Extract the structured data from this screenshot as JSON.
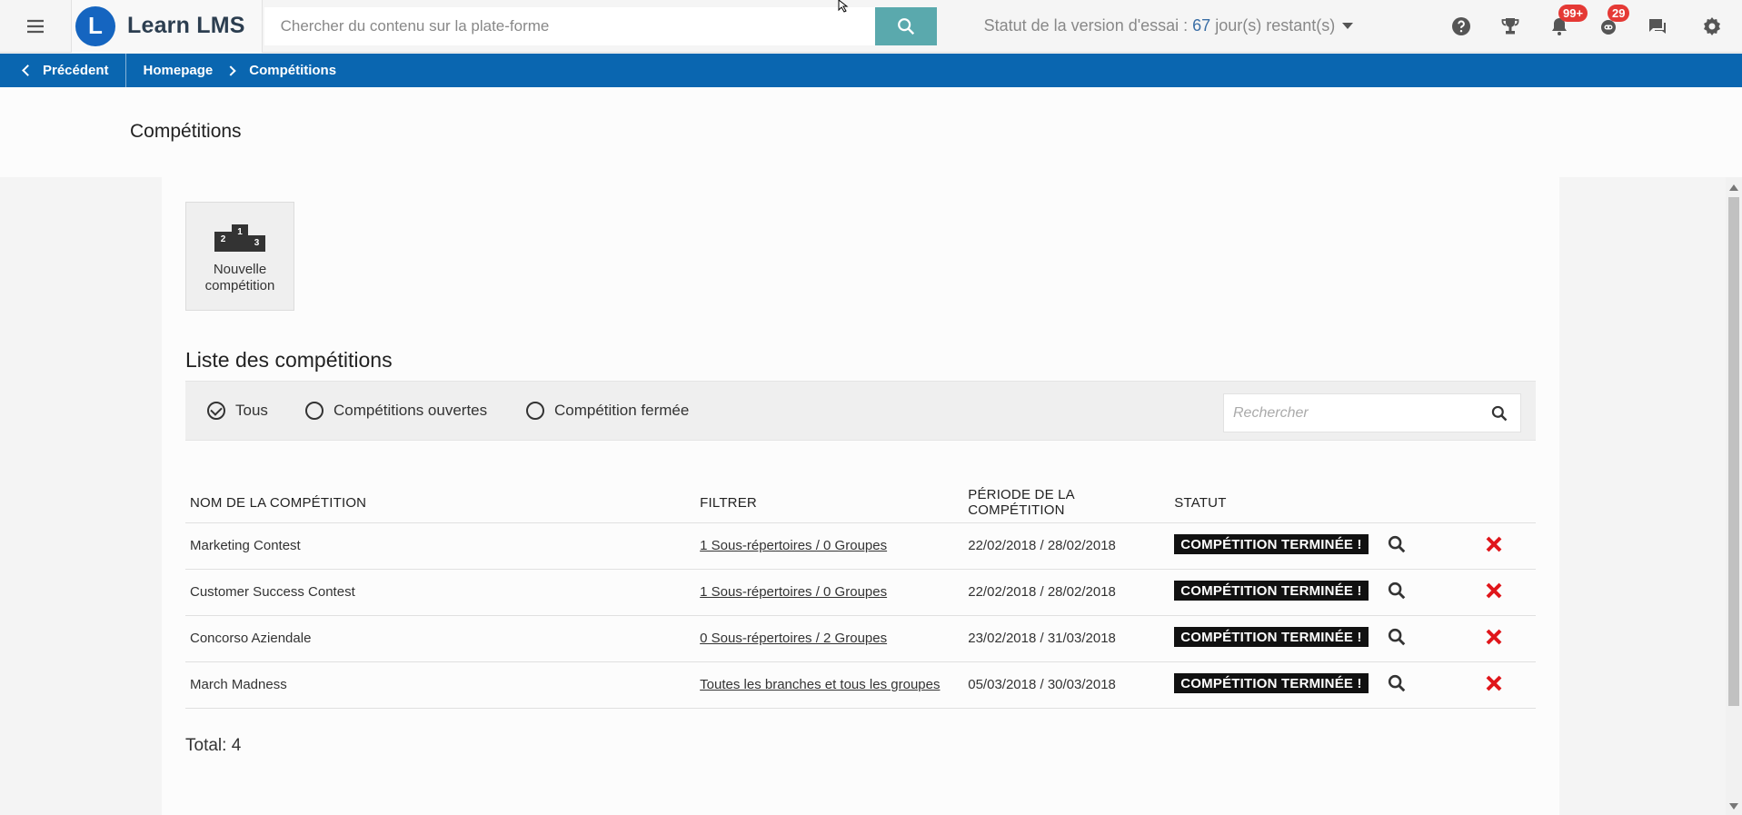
{
  "header": {
    "app_name": "Learn LMS",
    "logo_letter": "L",
    "search_placeholder": "Chercher du contenu sur la plate-forme",
    "trial_prefix": "Statut de la version d'essai :",
    "trial_days": "67",
    "trial_suffix": "jour(s) restant(s)",
    "icons": [
      "help-icon",
      "trophy-icon",
      "notifications-icon",
      "messages-robot-icon",
      "chat-icon",
      "settings-icon"
    ],
    "notifications_badge": "99+",
    "robot_badge": "29",
    "brand_color": "#1565c0",
    "search_button_color": "#5aa9ad"
  },
  "breadcrumb": {
    "back_label": "Précédent",
    "home_label": "Homepage",
    "current_label": "Compétitions",
    "bar_color": "#0a66b0"
  },
  "page": {
    "title": "Compétitions",
    "new_competition_label_1": "Nouvelle",
    "new_competition_label_2": "compétition",
    "list_title": "Liste des compétitions",
    "filters": [
      "Tous",
      "Compétitions ouvertes",
      "Compétition fermée"
    ],
    "selected_filter": "Tous",
    "list_search_placeholder": "Rechercher",
    "total_label": "Total:",
    "total_value": "4"
  },
  "table": {
    "headers": [
      "NOM DE LA COMPÉTITION",
      "FILTRER",
      "PÉRIODE DE LA COMPÉTITION",
      "STATUT"
    ],
    "rows": [
      {
        "name": "Marketing Contest",
        "filter": "1 Sous-répertoires / 0 Groupes",
        "period": "22/02/2018 / 28/02/2018",
        "status": "COMPÉTITION TERMINÉE !"
      },
      {
        "name": "Customer Success Contest",
        "filter": "1 Sous-répertoires / 0 Groupes",
        "period": "22/02/2018 / 28/02/2018",
        "status": "COMPÉTITION TERMINÉE !"
      },
      {
        "name": "Concorso Aziendale",
        "filter": "0 Sous-répertoires / 2 Groupes",
        "period": "23/02/2018 / 31/03/2018",
        "status": "COMPÉTITION TERMINÉE !"
      },
      {
        "name": "March Madness",
        "filter": "Toutes les branches et tous les groupes",
        "period": "05/03/2018 / 30/03/2018",
        "status": "COMPÉTITION TERMINÉE !"
      }
    ],
    "delete_color": "#e0161b"
  }
}
